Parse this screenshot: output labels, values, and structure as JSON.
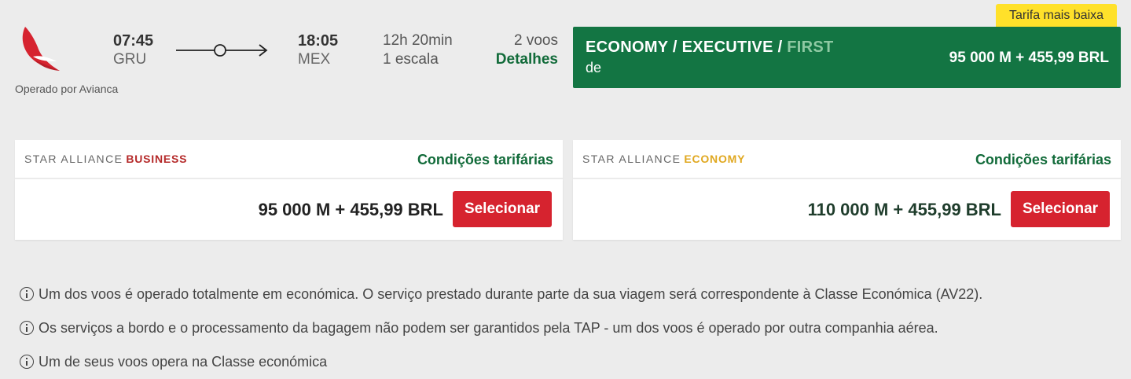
{
  "airline": {
    "logo_icon": "avianca-logo-icon",
    "operated_by": "Operado por Avianca",
    "brand_color": "#d6232f"
  },
  "flight": {
    "departure_time": "07:45",
    "departure_airport": "GRU",
    "arrival_time": "18:05",
    "arrival_airport": "MEX",
    "duration": "12h 20min",
    "stops": "1 escala",
    "flights_count": "2 voos",
    "details_link": "Detalhes"
  },
  "best_fare": {
    "badge": "Tarifa mais baixa",
    "classes_prefix": "ECONOMY / EXECUTIVE / ",
    "classes_highlight": "FIRST",
    "from_label": "de",
    "price": "95 000 M + 455,99 BRL",
    "bg_color": "#137543",
    "badge_color": "#ffe12a"
  },
  "fares": [
    {
      "alliance": "STAR ALLIANCE",
      "cabin": "BUSINESS",
      "conditions": "Condições tarifárias",
      "price": "95 000 M + 455,99 BRL",
      "button": "Selecionar",
      "cabin_color": "#b52a2a"
    },
    {
      "alliance": "STAR ALLIANCE",
      "cabin": "ECONOMY",
      "conditions": "Condições tarifárias",
      "price": "110 000 M + 455,99 BRL",
      "button": "Selecionar",
      "cabin_color": "#e0a820"
    }
  ],
  "notes": [
    "Um dos voos é operado totalmente em económica. O serviço prestado durante parte da sua viagem será correspondente à Classe Económica (AV22).",
    "Os serviços a bordo e o processamento da bagagem não podem ser garantidos pela TAP - um dos voos é operado por outra companhia aérea.",
    "Um de seus voos opera na Classe económica"
  ]
}
